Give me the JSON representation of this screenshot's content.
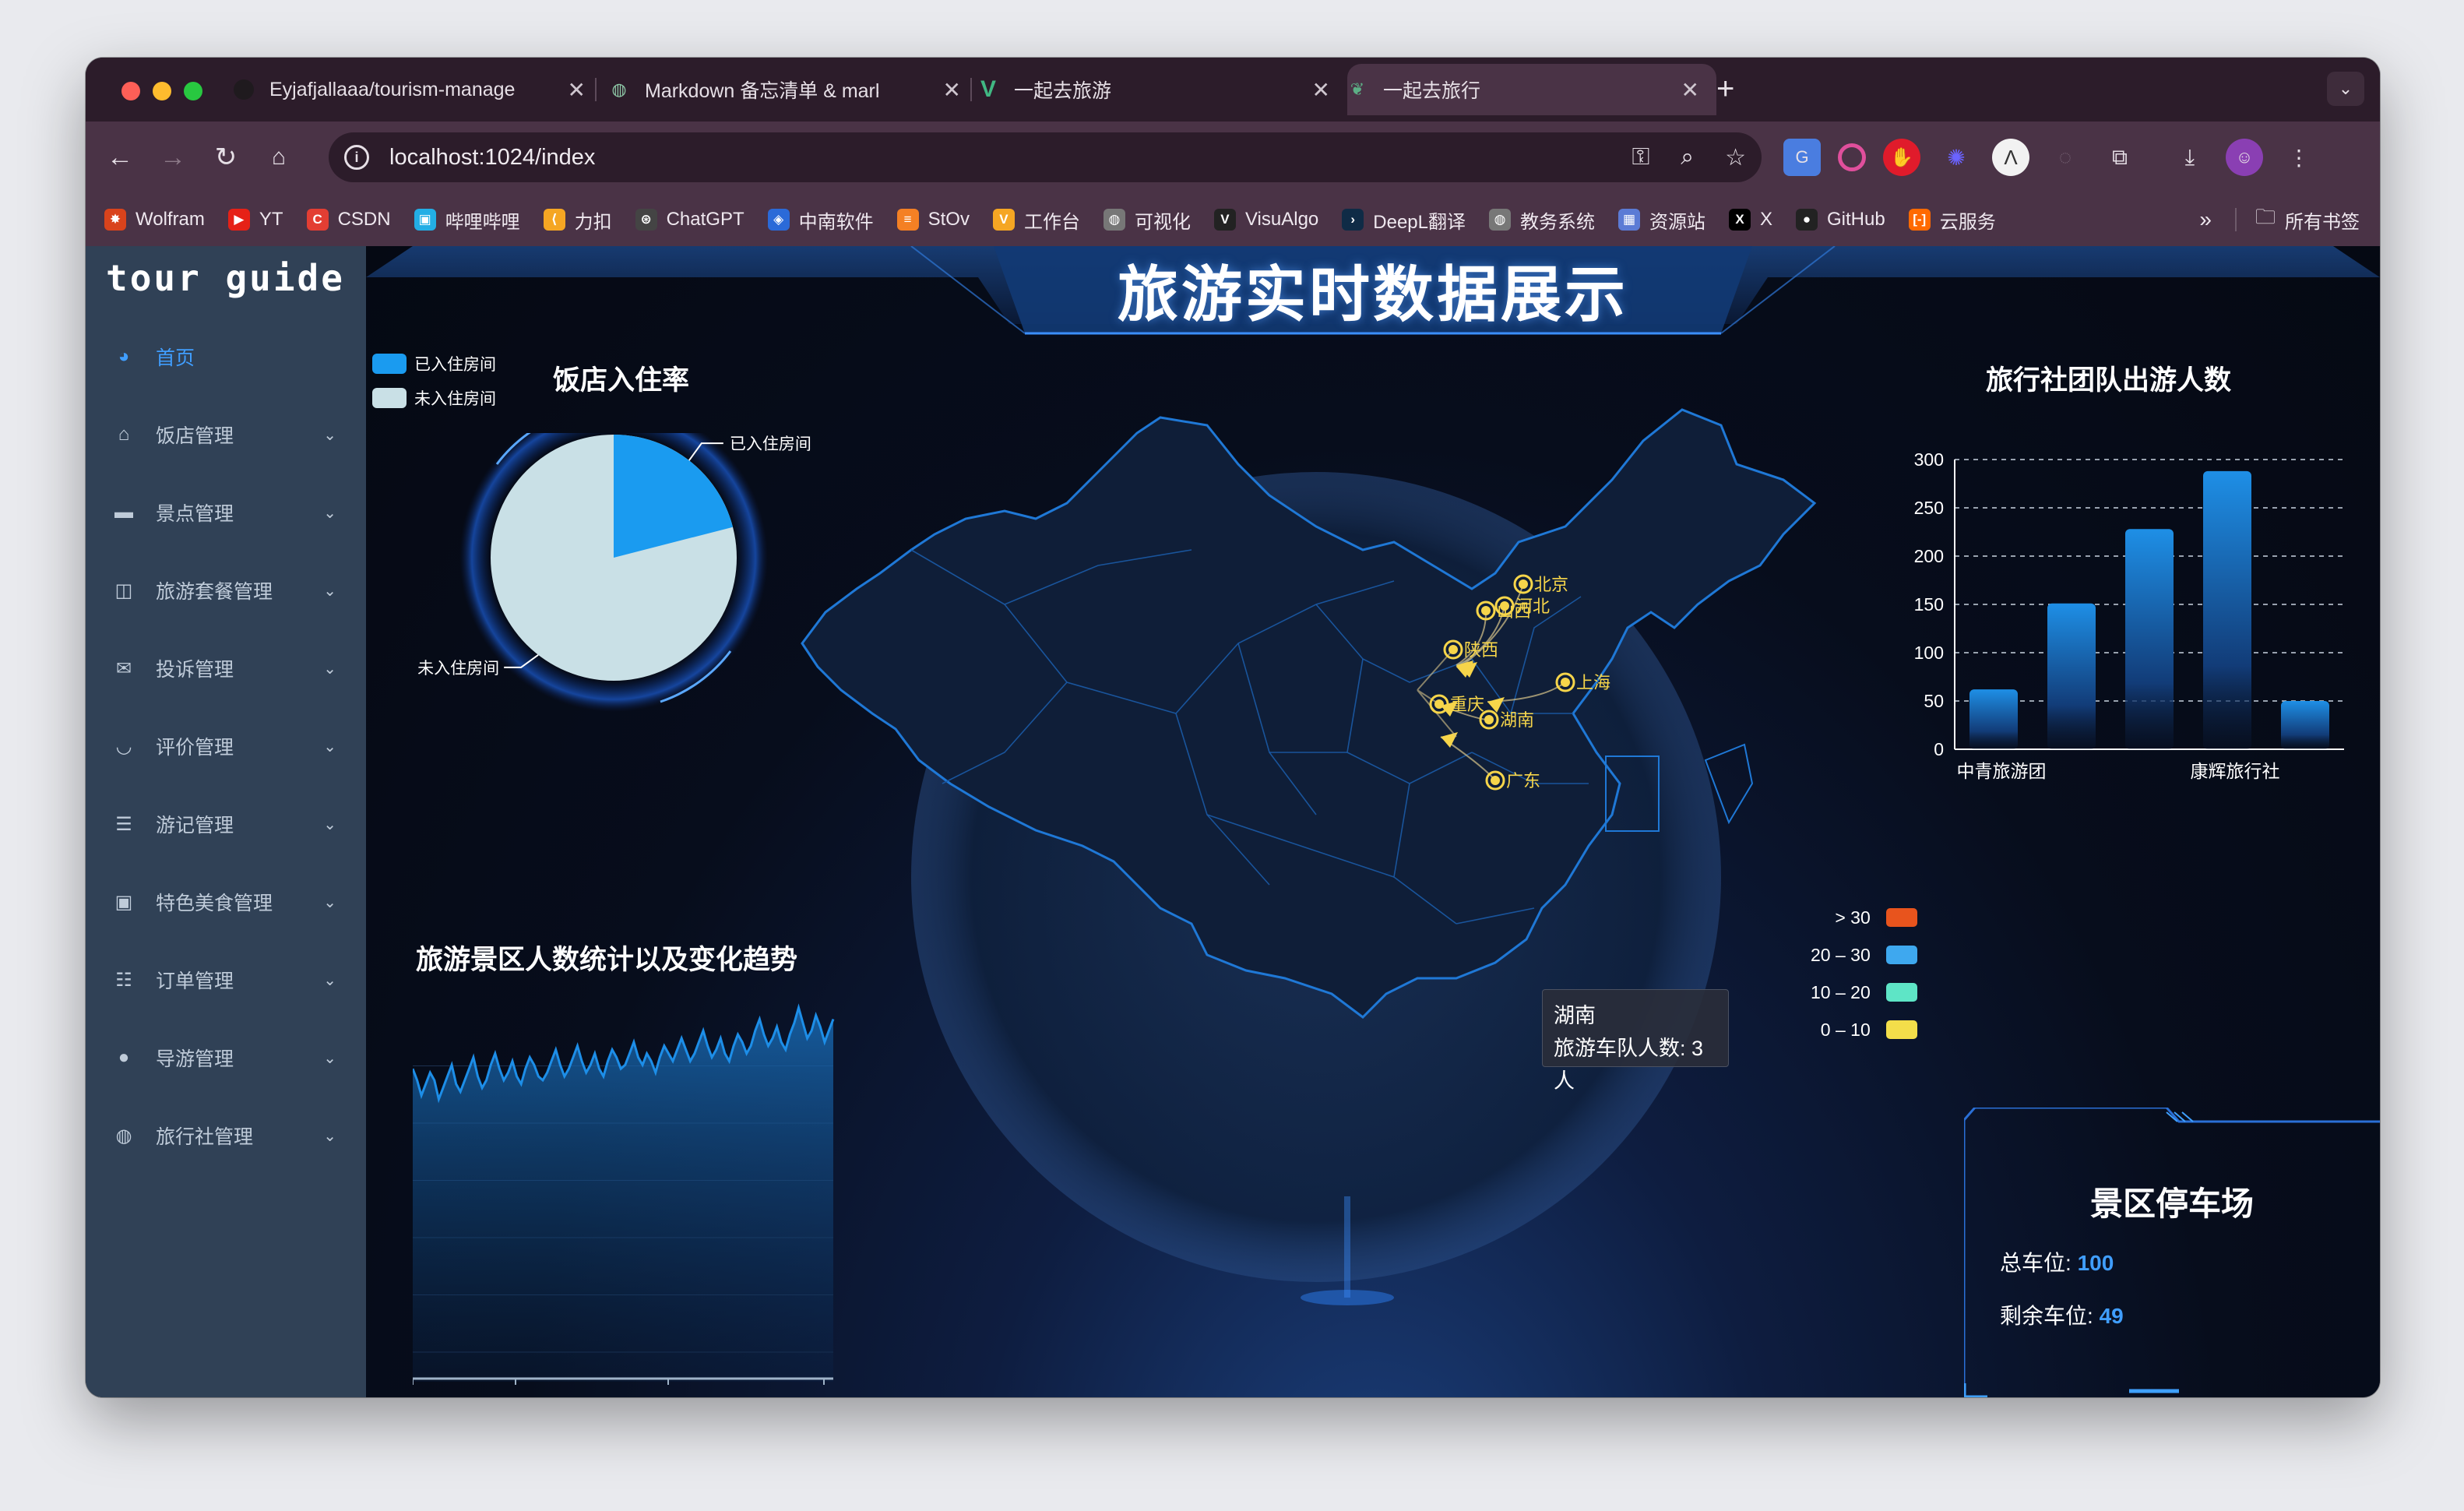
{
  "browser": {
    "tabs": [
      {
        "title": "Eyjafjallaaa/tourism-manage",
        "icon": "github-icon"
      },
      {
        "title": "Markdown 备忘清单 & markdown",
        "icon": "markdown-icon"
      },
      {
        "title": "一起去旅游",
        "icon": "vue-icon"
      },
      {
        "title": "一起去旅行",
        "icon": "leaf-icon"
      }
    ],
    "url": "localhost:1024/index",
    "bookmarks": [
      {
        "label": "Wolfram",
        "color": "#d9431c",
        "glyph": "✸"
      },
      {
        "label": "YT",
        "color": "#e62117",
        "glyph": "▶"
      },
      {
        "label": "CSDN",
        "color": "#e33e33",
        "glyph": "C"
      },
      {
        "label": "哔哩哔哩",
        "color": "#23aee5",
        "glyph": "▣"
      },
      {
        "label": "力扣",
        "color": "#f5a623",
        "glyph": "⟨"
      },
      {
        "label": "ChatGPT",
        "color": "#444444",
        "glyph": "⊛"
      },
      {
        "label": "中南软件",
        "color": "#2b6ad8",
        "glyph": "◈"
      },
      {
        "label": "StOv",
        "color": "#f48024",
        "glyph": "≡"
      },
      {
        "label": "工作台",
        "color": "#f5a623",
        "glyph": "V"
      },
      {
        "label": "可视化",
        "color": "#777777",
        "glyph": "◍"
      },
      {
        "label": "VisuAlgo",
        "color": "#222222",
        "glyph": "V"
      },
      {
        "label": "DeepL翻译",
        "color": "#0f2b46",
        "glyph": "›"
      },
      {
        "label": "教务系统",
        "color": "#777777",
        "glyph": "◍"
      },
      {
        "label": "资源站",
        "color": "#5b7bd5",
        "glyph": "▦"
      },
      {
        "label": "X",
        "color": "#000000",
        "glyph": "X"
      },
      {
        "label": "GitHub",
        "color": "#222222",
        "glyph": "●"
      },
      {
        "label": "云服务",
        "color": "#ff6a00",
        "glyph": "[-]"
      }
    ],
    "all_bookmarks": "所有书签"
  },
  "sidebar": {
    "logo": "tour guide",
    "items": [
      {
        "label": "首页",
        "icon": "dashboard-icon",
        "glyph": "◕"
      },
      {
        "label": "饭店管理",
        "icon": "hotel-icon",
        "glyph": "⌂"
      },
      {
        "label": "景点管理",
        "icon": "chat-icon",
        "glyph": "▬"
      },
      {
        "label": "旅游套餐管理",
        "icon": "book-icon",
        "glyph": "◫"
      },
      {
        "label": "投诉管理",
        "icon": "mail-icon",
        "glyph": "✉"
      },
      {
        "label": "评价管理",
        "icon": "eye-icon",
        "glyph": "◡"
      },
      {
        "label": "游记管理",
        "icon": "list-icon",
        "glyph": "☰"
      },
      {
        "label": "特色美食管理",
        "icon": "image-icon",
        "glyph": "▣"
      },
      {
        "label": "订单管理",
        "icon": "order-list-icon",
        "glyph": "☷"
      },
      {
        "label": "导游管理",
        "icon": "user-icon",
        "glyph": "●"
      },
      {
        "label": "旅行社管理",
        "icon": "globe-icon",
        "glyph": "◍"
      }
    ]
  },
  "dashboard": {
    "title": "旅游实时数据展示",
    "pie": {
      "title": "饭店入住率",
      "legend": [
        "已入住房间",
        "未入住房间"
      ],
      "colors": [
        "#1a9bf0",
        "#c9e0e6"
      ],
      "occupied_fraction": 0.21
    },
    "line": {
      "title": "旅游景区人数统计以及变化趋势",
      "values": [
        82,
        79,
        75,
        78,
        81,
        79,
        74,
        77,
        80,
        83,
        78,
        76,
        79,
        82,
        85,
        80,
        77,
        79,
        83,
        86,
        82,
        79,
        81,
        84,
        80,
        78,
        82,
        85,
        83,
        80,
        79,
        81,
        84,
        87,
        83,
        80,
        82,
        85,
        88,
        84,
        81,
        83,
        86,
        82,
        80,
        84,
        87,
        85,
        82,
        83,
        86,
        89,
        85,
        83,
        86,
        84,
        81,
        85,
        88,
        86,
        84,
        87,
        90,
        87,
        84,
        86,
        89,
        92,
        88,
        85,
        87,
        90,
        86,
        84,
        88,
        91,
        89,
        86,
        88,
        92,
        95,
        91,
        88,
        90,
        93,
        89,
        87,
        91,
        94,
        98,
        94,
        90,
        92,
        96,
        93,
        89,
        92,
        95
      ]
    },
    "bar": {
      "title": "旅行社团队出游人数",
      "y_ticks": [
        "300",
        "250",
        "200",
        "150",
        "100",
        "50",
        "0"
      ],
      "x_labels": [
        "中青旅游团",
        "康辉旅行社"
      ],
      "values": [
        62,
        151,
        228,
        288,
        50
      ]
    },
    "map": {
      "cities": [
        "北京",
        "河北",
        "山西",
        "陕西",
        "上海",
        "重庆",
        "湖南",
        "广东"
      ],
      "tooltip": {
        "region": "湖南",
        "text": "旅游车队人数: 3人"
      },
      "visual_map": [
        {
          "label": "> 30",
          "color": "#e8541d"
        },
        {
          "label": "20 – 30",
          "color": "#3ea8ef"
        },
        {
          "label": "10 – 20",
          "color": "#5ee5c6"
        },
        {
          "label": "0 – 10",
          "color": "#f3de4a"
        }
      ]
    },
    "parking": {
      "title": "景区停车场",
      "total_label": "总车位:",
      "total": "100",
      "remain_label": "剩余车位:",
      "remain": "49"
    }
  }
}
